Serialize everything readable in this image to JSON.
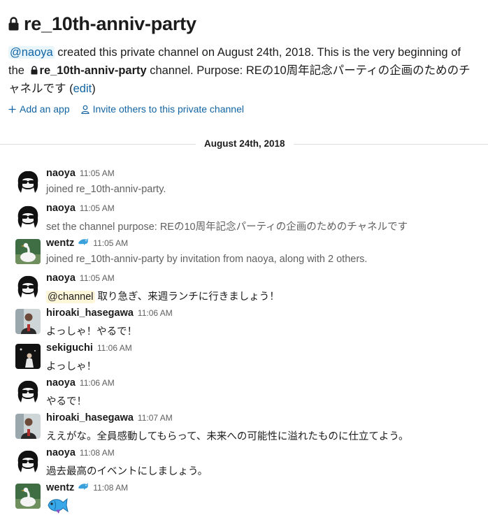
{
  "channel": {
    "name": "re_10th-anniv-party",
    "intro": {
      "mention": "@naoya",
      "text_1": " created this private channel on August 24th, 2018. This is the very beginning of the ",
      "channel_ref": "re_10th-anniv-party",
      "text_2": " channel. Purpose: REの10周年記念パーティの企画のためのチャネルです (",
      "edit_link": "edit",
      "text_3": ")"
    },
    "actions": {
      "add_app": "Add an app",
      "invite": "Invite others to this private channel"
    }
  },
  "day_divider": "August 24th, 2018",
  "messages": [
    {
      "user": "naoya",
      "time": "11:05 AM",
      "text": "joined re_10th-anniv-party.",
      "system": true
    },
    {
      "user": "naoya",
      "time": "11:05 AM",
      "text": "set the channel purpose: REの10周年記念パーティの企画のためのチャネルです",
      "system": true
    },
    {
      "user": "wentz",
      "time": "11:05 AM",
      "text": "joined re_10th-anniv-party by invitation from naoya, along with 2 others.",
      "system": true,
      "status_emoji": "dolphin"
    },
    {
      "user": "naoya",
      "time": "11:05 AM",
      "mention": "@channel",
      "text": "取り急ぎ、来週ランチに行きましょう！"
    },
    {
      "user": "hiroaki_hasegawa",
      "time": "11:06 AM",
      "text": "よっしゃ！やるで！"
    },
    {
      "user": "sekiguchi",
      "time": "11:06 AM",
      "text": "よっしゃ！"
    },
    {
      "user": "naoya",
      "time": "11:06 AM",
      "text": "やるで！"
    },
    {
      "user": "hiroaki_hasegawa",
      "time": "11:07 AM",
      "text": "ええがな。全員感動してもらって、未来への可能性に溢れたものに仕立てよう。"
    },
    {
      "user": "naoya",
      "time": "11:08 AM",
      "text": "過去最高のイベントにしましょう。"
    },
    {
      "user": "wentz",
      "time": "11:08 AM",
      "emoji": "fish",
      "status_emoji": "dolphin"
    }
  ],
  "colors": {
    "link": "#1264a3",
    "mention_bg": "#e8f5fa",
    "channel_mention_bg": "#fdf6d8",
    "divider": "#dddddd"
  }
}
